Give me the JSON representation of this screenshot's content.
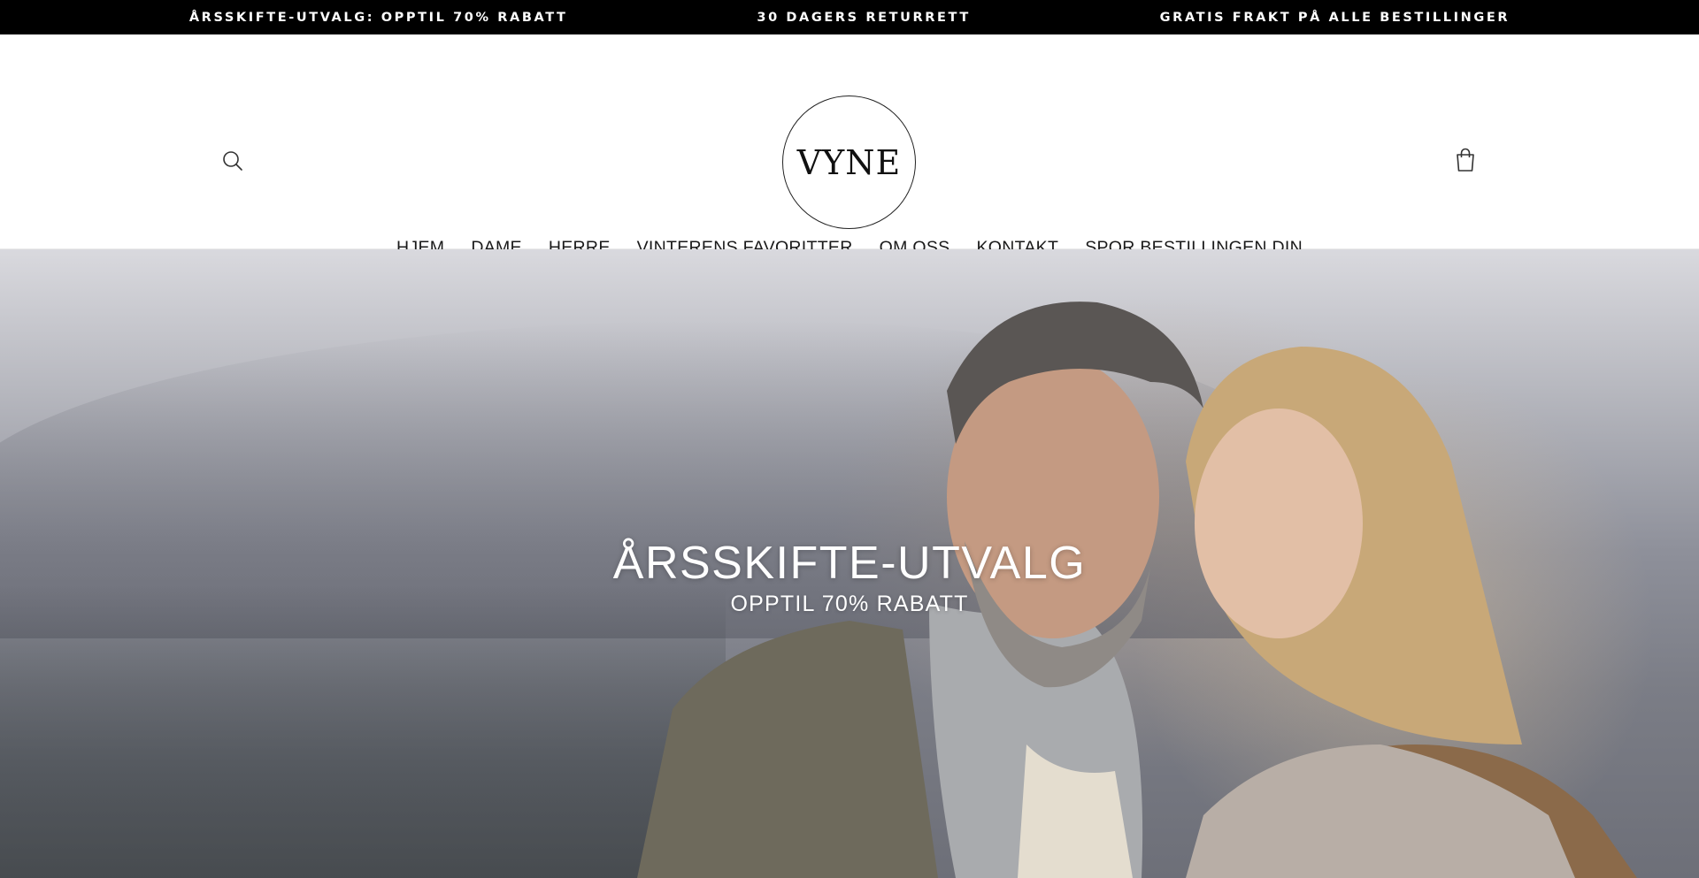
{
  "announcement_bar": {
    "items": [
      "ÅRSSKIFTE-UTVALG: OPPTIL 70% RABATT",
      "30 DAGERS RETURRETT",
      "GRATIS FRAKT PÅ ALLE BESTILLINGER"
    ]
  },
  "header": {
    "logo_text": "VYNE",
    "search_icon": "search-icon",
    "cart_icon": "shopping-bag-icon"
  },
  "nav": {
    "items": [
      "HJEM",
      "DAME",
      "HERRE",
      "VINTERENS FAVORITTER",
      "OM OSS",
      "KONTAKT",
      "SPOR BESTILLINGEN DIN"
    ]
  },
  "hero": {
    "title": "ÅRSSKIFTE-UTVALG",
    "subtitle": "OPPTIL 70% RABATT"
  },
  "colors": {
    "announcement_bg": "#000000",
    "announcement_text": "#ffffff",
    "page_bg": "#ffffff",
    "nav_text": "#1a1a1a",
    "hero_text": "#ffffff"
  }
}
